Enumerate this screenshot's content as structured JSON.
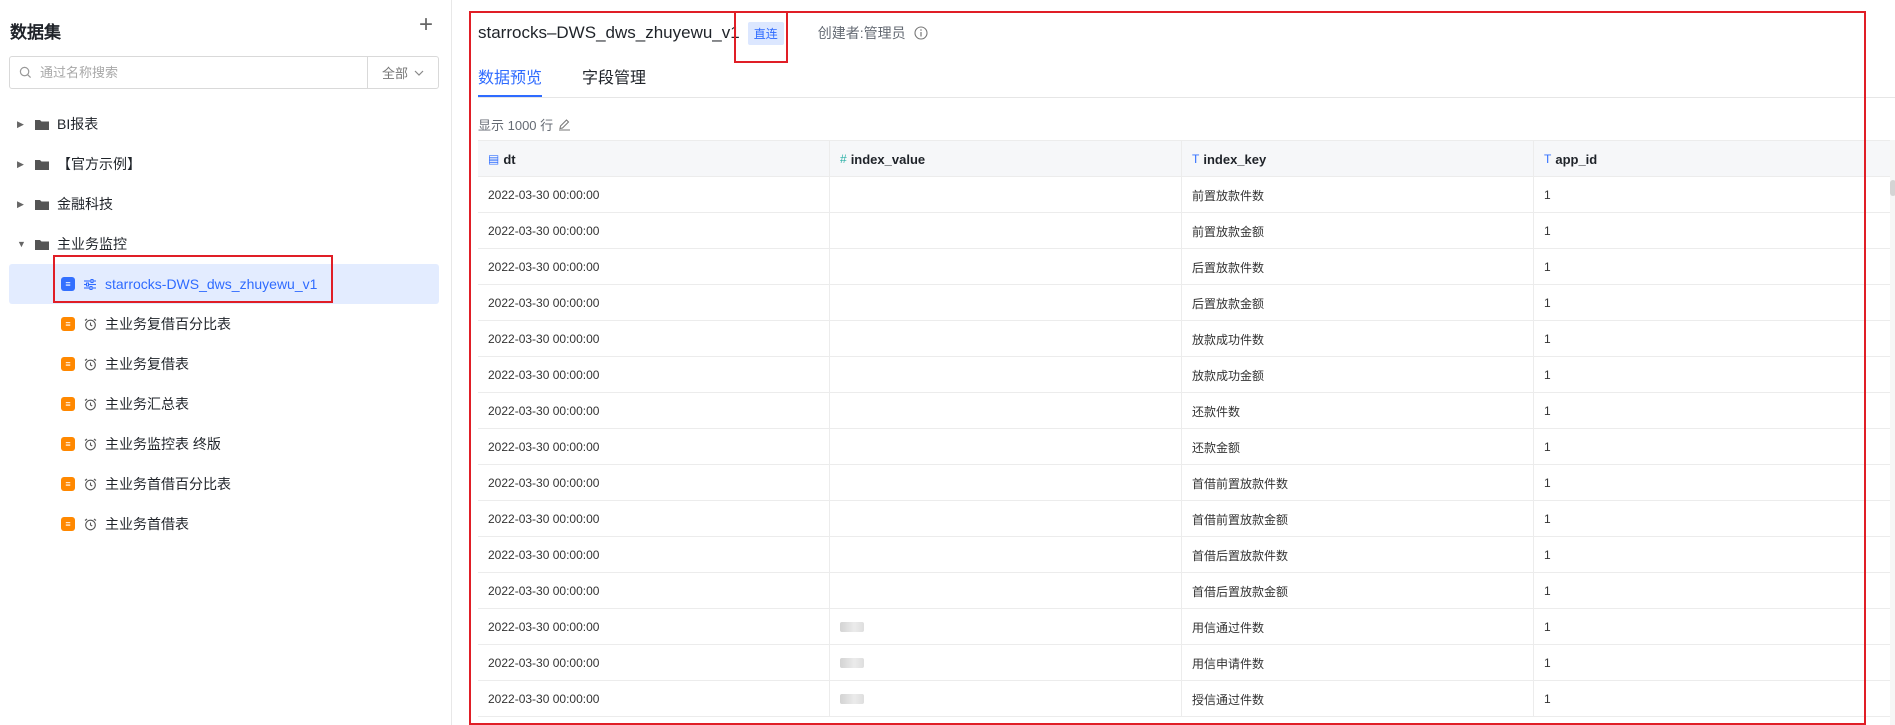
{
  "sidebar": {
    "title": "数据集",
    "add_icon": "plus-icon",
    "search_placeholder": "通过名称搜索",
    "filter_label": "全部",
    "folders": [
      {
        "label": "BI报表",
        "expanded": false
      },
      {
        "label": "【官方示例】",
        "expanded": false
      },
      {
        "label": "金融科技",
        "expanded": false
      },
      {
        "label": "主业务监控",
        "expanded": true
      }
    ],
    "items": [
      {
        "label": "starrocks-DWS_dws_zhuyewu_v1",
        "icon": "sliders-icon",
        "badge_color": "#3370ff",
        "selected": true
      },
      {
        "label": "主业务复借百分比表",
        "icon": "alarm-clock-icon",
        "badge_color": "#ff8800",
        "selected": false
      },
      {
        "label": "主业务复借表",
        "icon": "alarm-clock-icon",
        "badge_color": "#ff8800",
        "selected": false
      },
      {
        "label": "主业务汇总表",
        "icon": "alarm-clock-icon",
        "badge_color": "#ff8800",
        "selected": false
      },
      {
        "label": "主业务监控表 终版",
        "icon": "alarm-clock-icon",
        "badge_color": "#ff8800",
        "selected": false
      },
      {
        "label": "主业务首借百分比表",
        "icon": "alarm-clock-icon",
        "badge_color": "#ff8800",
        "selected": false
      },
      {
        "label": "主业务首借表",
        "icon": "alarm-clock-icon",
        "badge_color": "#ff8800",
        "selected": false
      }
    ]
  },
  "header": {
    "title": "starrocks–DWS_dws_zhuyewu_v1",
    "tag": "直连",
    "creator": "创建者:管理员"
  },
  "tabs": [
    {
      "label": "数据预览",
      "active": true
    },
    {
      "label": "字段管理",
      "active": false
    }
  ],
  "preview": {
    "rows_label": "显示 1000 行"
  },
  "table": {
    "columns": [
      {
        "name": "dt",
        "type_icon": "▤"
      },
      {
        "name": "index_value",
        "type_icon": "#"
      },
      {
        "name": "index_key",
        "type_icon": "T"
      },
      {
        "name": "app_id",
        "type_icon": "T"
      }
    ],
    "rows": [
      [
        "2022-03-30 00:00:00",
        "",
        "前置放款件数",
        "1"
      ],
      [
        "2022-03-30 00:00:00",
        "",
        "前置放款金额",
        "1"
      ],
      [
        "2022-03-30 00:00:00",
        "",
        "后置放款件数",
        "1"
      ],
      [
        "2022-03-30 00:00:00",
        "",
        "后置放款金额",
        "1"
      ],
      [
        "2022-03-30 00:00:00",
        "",
        "放款成功件数",
        "1"
      ],
      [
        "2022-03-30 00:00:00",
        "",
        "放款成功金额",
        "1"
      ],
      [
        "2022-03-30 00:00:00",
        "",
        "还款件数",
        "1"
      ],
      [
        "2022-03-30 00:00:00",
        "",
        "还款金额",
        "1"
      ],
      [
        "2022-03-30 00:00:00",
        "",
        "首借前置放款件数",
        "1"
      ],
      [
        "2022-03-30 00:00:00",
        "",
        "首借前置放款金额",
        "1"
      ],
      [
        "2022-03-30 00:00:00",
        "",
        "首借后置放款件数",
        "1"
      ],
      [
        "2022-03-30 00:00:00",
        "",
        "首借后置放款金额",
        "1"
      ],
      [
        "2022-03-30 00:00:00",
        "blurred",
        "用信通过件数",
        "1"
      ],
      [
        "2022-03-30 00:00:00",
        "blurred",
        "用信申请件数",
        "1"
      ],
      [
        "2022-03-30 00:00:00",
        "blurred",
        "授信通过件数",
        "1"
      ]
    ]
  },
  "colors": {
    "accent": "#2f6bff",
    "highlight": "#e01e26",
    "selected_bg": "#e3ecff"
  }
}
